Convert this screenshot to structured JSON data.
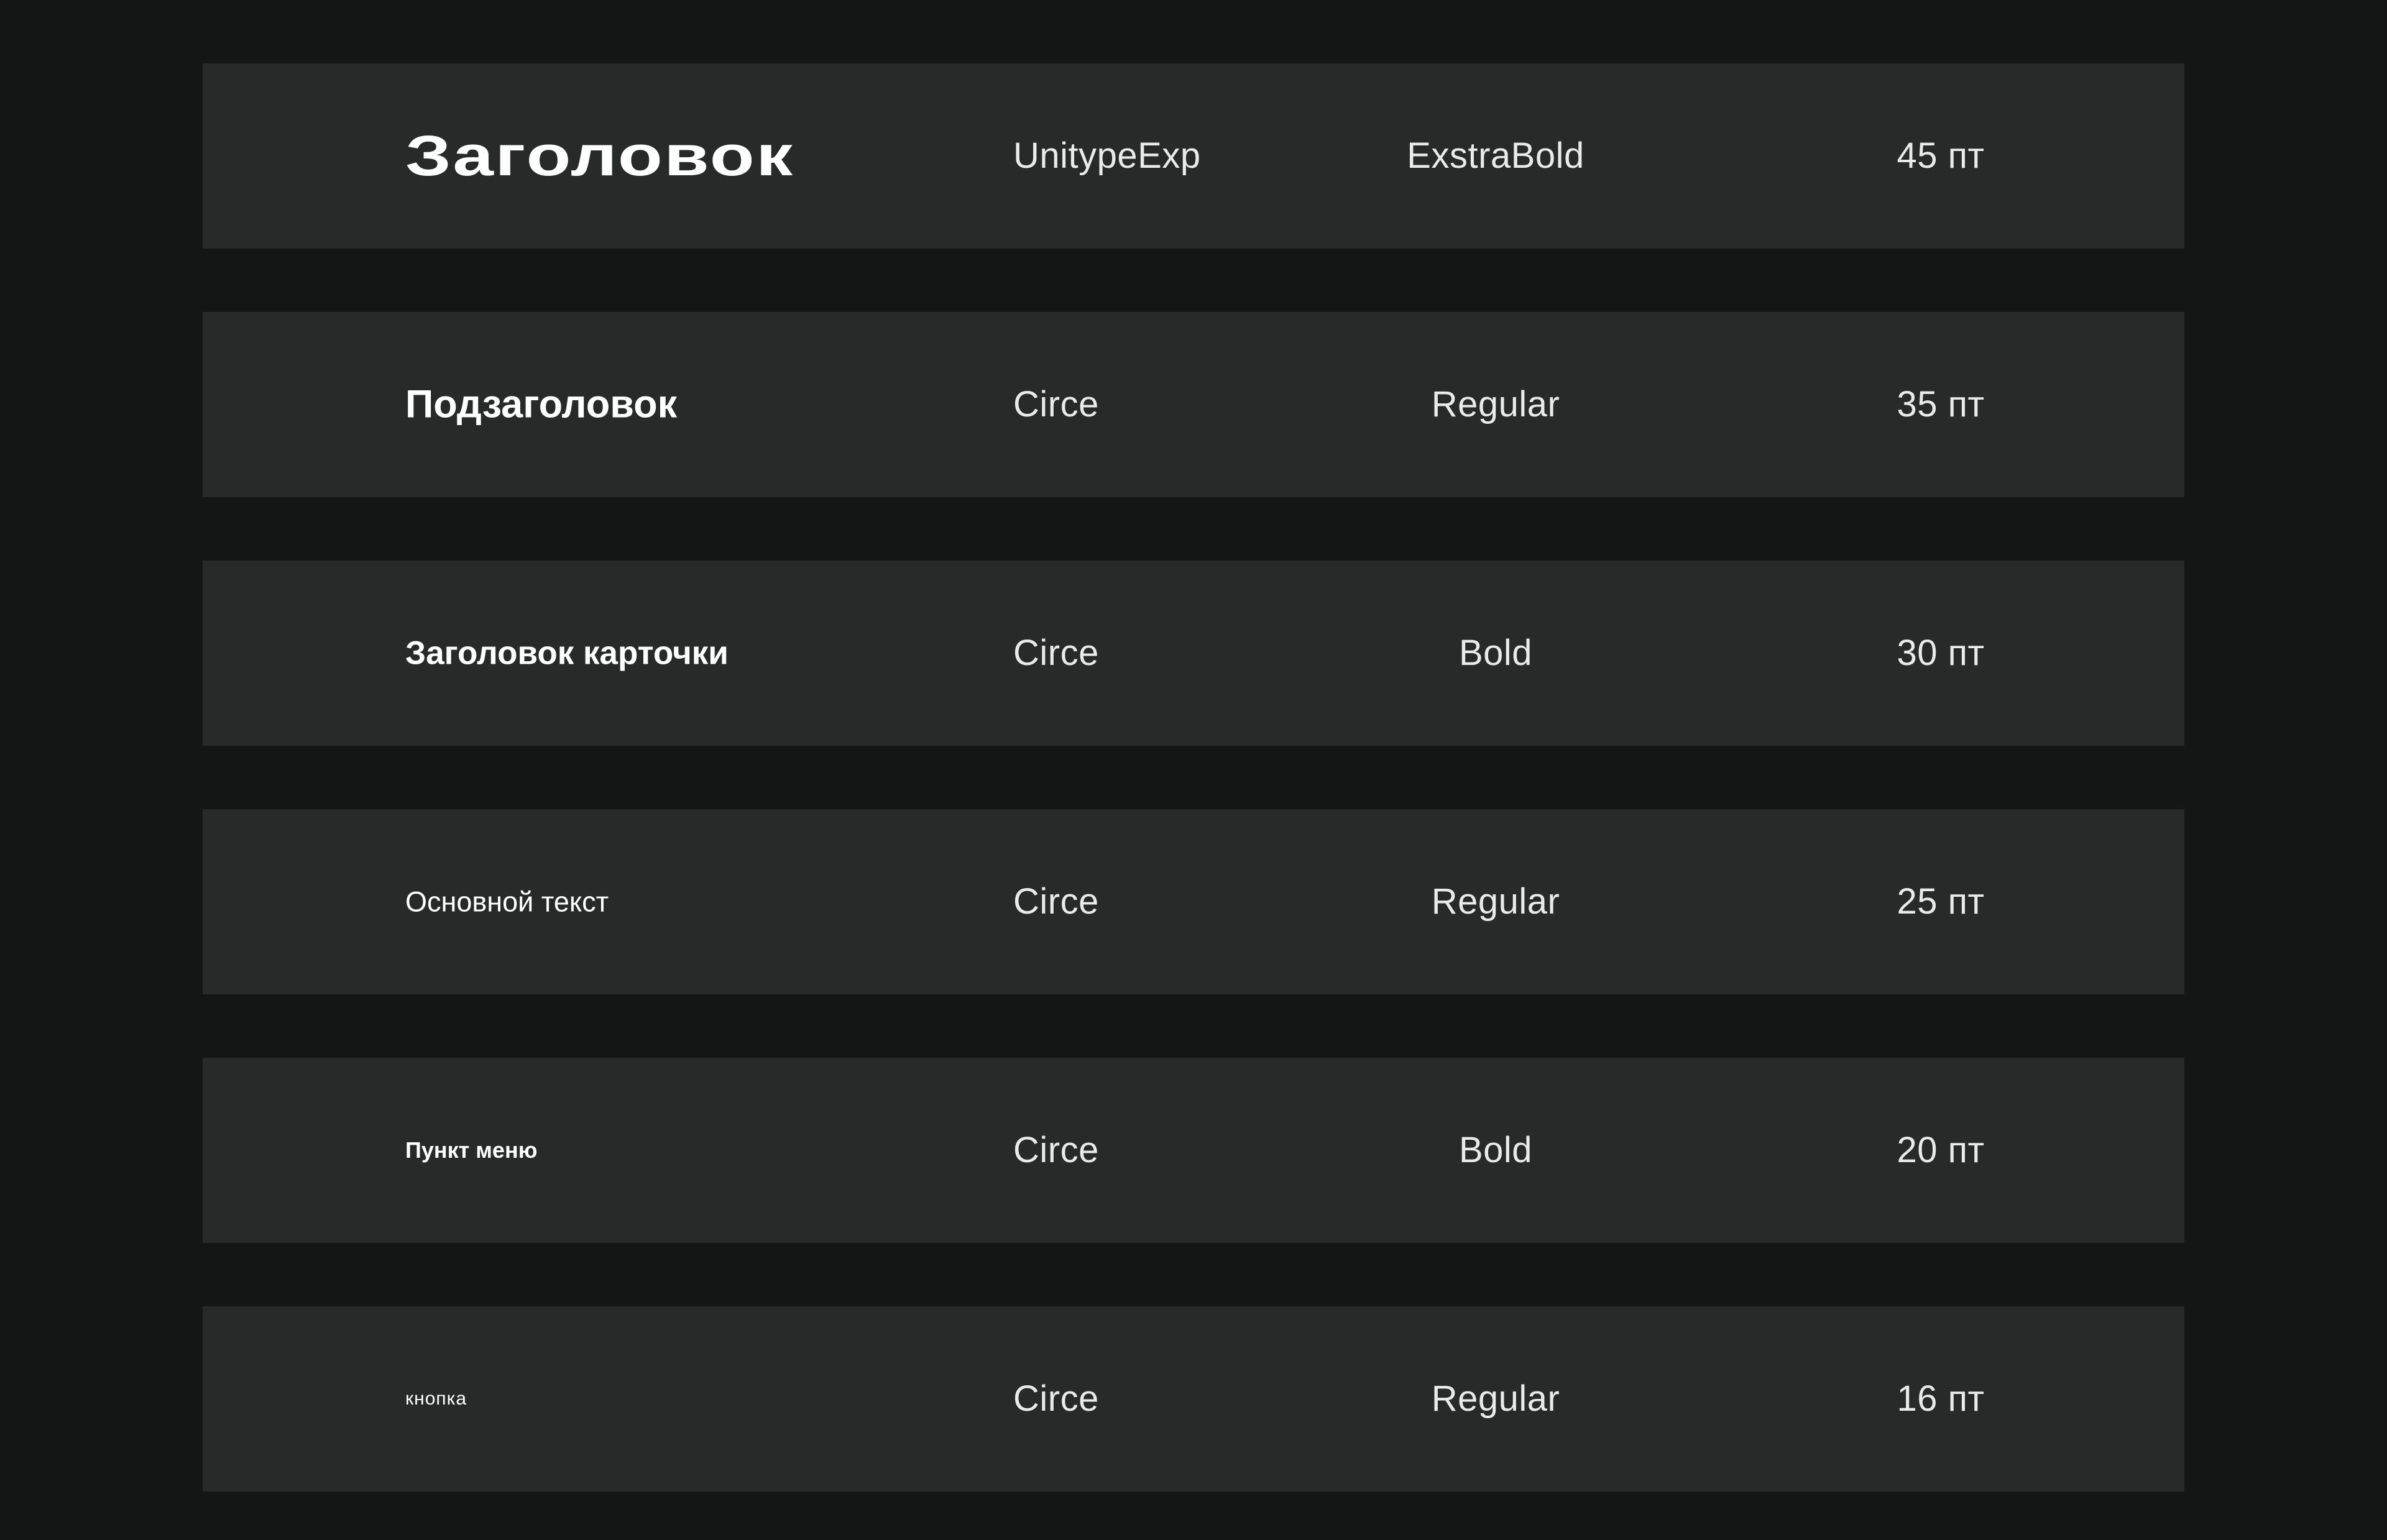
{
  "rows": [
    {
      "sample": "Заголовок",
      "font": "UnitypeExp",
      "weight": "ExstraBold",
      "size": "45 пт"
    },
    {
      "sample": "Подзаголовок",
      "font": "Circe",
      "weight": "Regular",
      "size": "35 пт"
    },
    {
      "sample": "Заголовок карточки",
      "font": "Circe",
      "weight": "Bold",
      "size": "30 пт"
    },
    {
      "sample": "Основной текст",
      "font": "Circe",
      "weight": "Regular",
      "size": "25 пт"
    },
    {
      "sample": "Пункт меню",
      "font": "Circe",
      "weight": "Bold",
      "size": "20 пт"
    },
    {
      "sample": "кнопка",
      "font": "Circe",
      "weight": "Regular",
      "size": "16 пт"
    }
  ],
  "colors": {
    "background": "#141515",
    "row_background": "#282a2a",
    "text": "#ffffff"
  }
}
